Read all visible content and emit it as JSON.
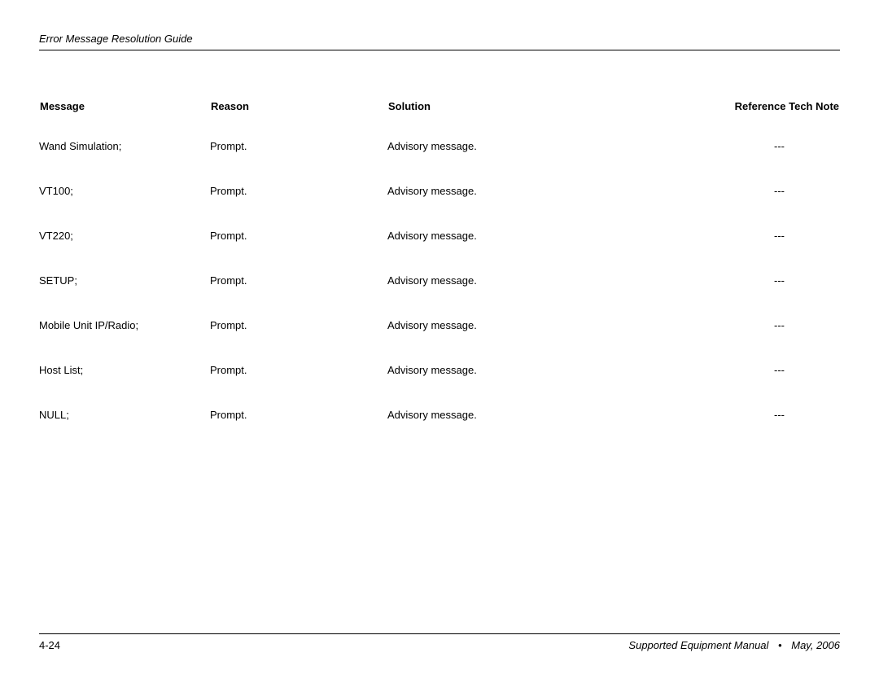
{
  "header": {
    "title": "Error Message Resolution Guide"
  },
  "table": {
    "columns": {
      "message": "Message",
      "reason": "Reason",
      "solution": "Solution",
      "reference": "Reference Tech Note"
    },
    "rows": [
      {
        "message": "Wand Simulation;",
        "reason": "Prompt.",
        "solution": "Advisory message.",
        "reference": "---"
      },
      {
        "message": "VT100;",
        "reason": "Prompt.",
        "solution": "Advisory message.",
        "reference": "---"
      },
      {
        "message": "VT220;",
        "reason": "Prompt.",
        "solution": "Advisory message.",
        "reference": "---"
      },
      {
        "message": "SETUP;",
        "reason": "Prompt.",
        "solution": "Advisory message.",
        "reference": "---"
      },
      {
        "message": "Mobile Unit IP/Radio;",
        "reason": "Prompt.",
        "solution": "Advisory message.",
        "reference": "---"
      },
      {
        "message": "Host List;",
        "reason": "Prompt.",
        "solution": "Advisory message.",
        "reference": "---"
      },
      {
        "message": "NULL;",
        "reason": "Prompt.",
        "solution": "Advisory message.",
        "reference": "---"
      }
    ]
  },
  "footer": {
    "page_number": "4-24",
    "doc_title": "Supported Equipment Manual",
    "bullet": "•",
    "date": "May, 2006"
  }
}
